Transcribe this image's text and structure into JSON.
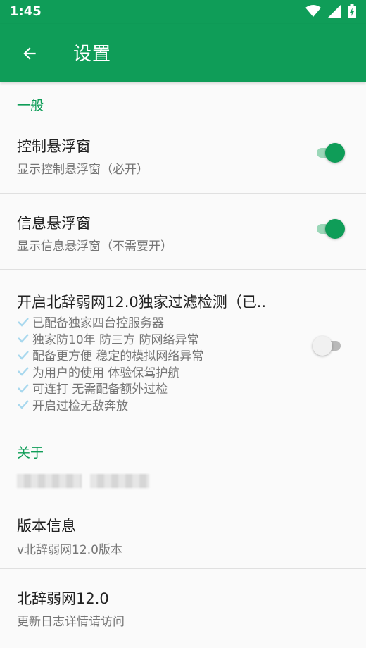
{
  "status_bar": {
    "time": "1:45"
  },
  "app_bar": {
    "title": "设置"
  },
  "sections": {
    "general": {
      "header": "一般"
    },
    "about": {
      "header": "关于"
    }
  },
  "prefs": {
    "control_window": {
      "title": "控制悬浮窗",
      "summary": "显示控制悬浮窗（必开）",
      "enabled": true
    },
    "info_window": {
      "title": "信息悬浮窗",
      "summary": "显示信息悬浮窗（不需要开）",
      "enabled": true
    },
    "filter_detection": {
      "title": "开启北辞弱网12.0独家过滤检测（已..",
      "lines": [
        "已配备独家四台控服务器",
        "独家防10年 防三方 防网络异常",
        "配备更方便 稳定的模拟网络异常",
        "为用户的使用 体验保驾护航",
        "可连打 无需配备额外过检",
        "开启过检无敌奔放"
      ],
      "enabled": false
    },
    "version_info": {
      "title": "版本信息",
      "summary": "v北辞弱网12.0版本"
    },
    "changelog": {
      "title": "北辞弱网12.0",
      "summary": "更新日志详情请访问"
    }
  },
  "colors": {
    "accent": "#0f9d58",
    "check": "#a8d8ee"
  }
}
